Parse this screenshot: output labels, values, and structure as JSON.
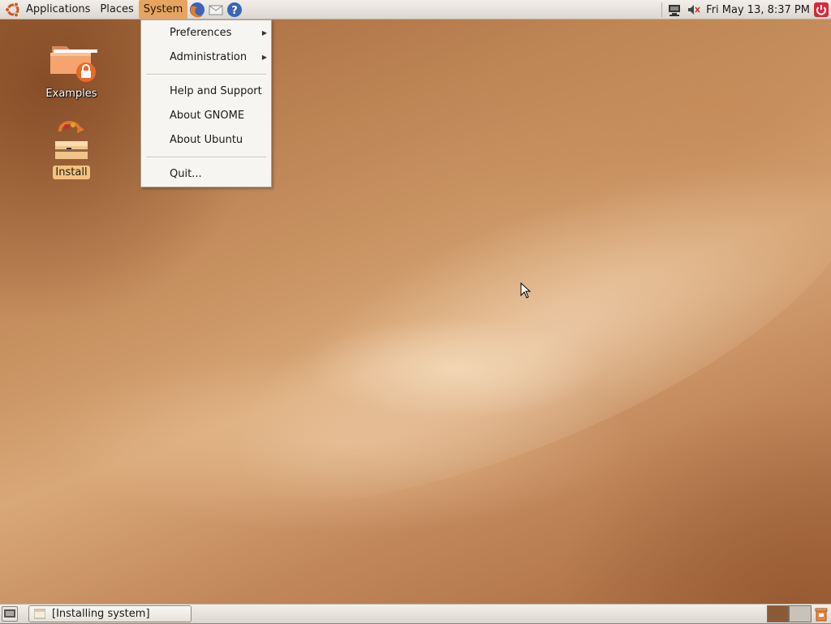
{
  "top_panel": {
    "menus": [
      "Applications",
      "Places",
      "System"
    ],
    "launchers": [
      "firefox-icon",
      "mail-icon",
      "help-icon"
    ],
    "clock": "Fri May 13,  8:37 PM"
  },
  "system_menu": {
    "items": [
      {
        "label": "Preferences",
        "submenu": true
      },
      {
        "label": "Administration",
        "submenu": true
      },
      {
        "label": "Help and Support"
      },
      {
        "label": "About GNOME"
      },
      {
        "label": "About Ubuntu"
      },
      {
        "label": "Quit..."
      }
    ]
  },
  "desktop_icons": [
    {
      "label": "Examples",
      "icon": "folder-icon"
    },
    {
      "label": "Install",
      "icon": "installer-icon"
    }
  ],
  "bottom_panel": {
    "task": "[Installing system]",
    "workspaces": 2
  },
  "colors": {
    "menu_highlight": "#e6a45e",
    "wallpaper": "#c99362",
    "workspace_active": "#8a5a36",
    "workspace_inactive": "#c8c2b8"
  }
}
